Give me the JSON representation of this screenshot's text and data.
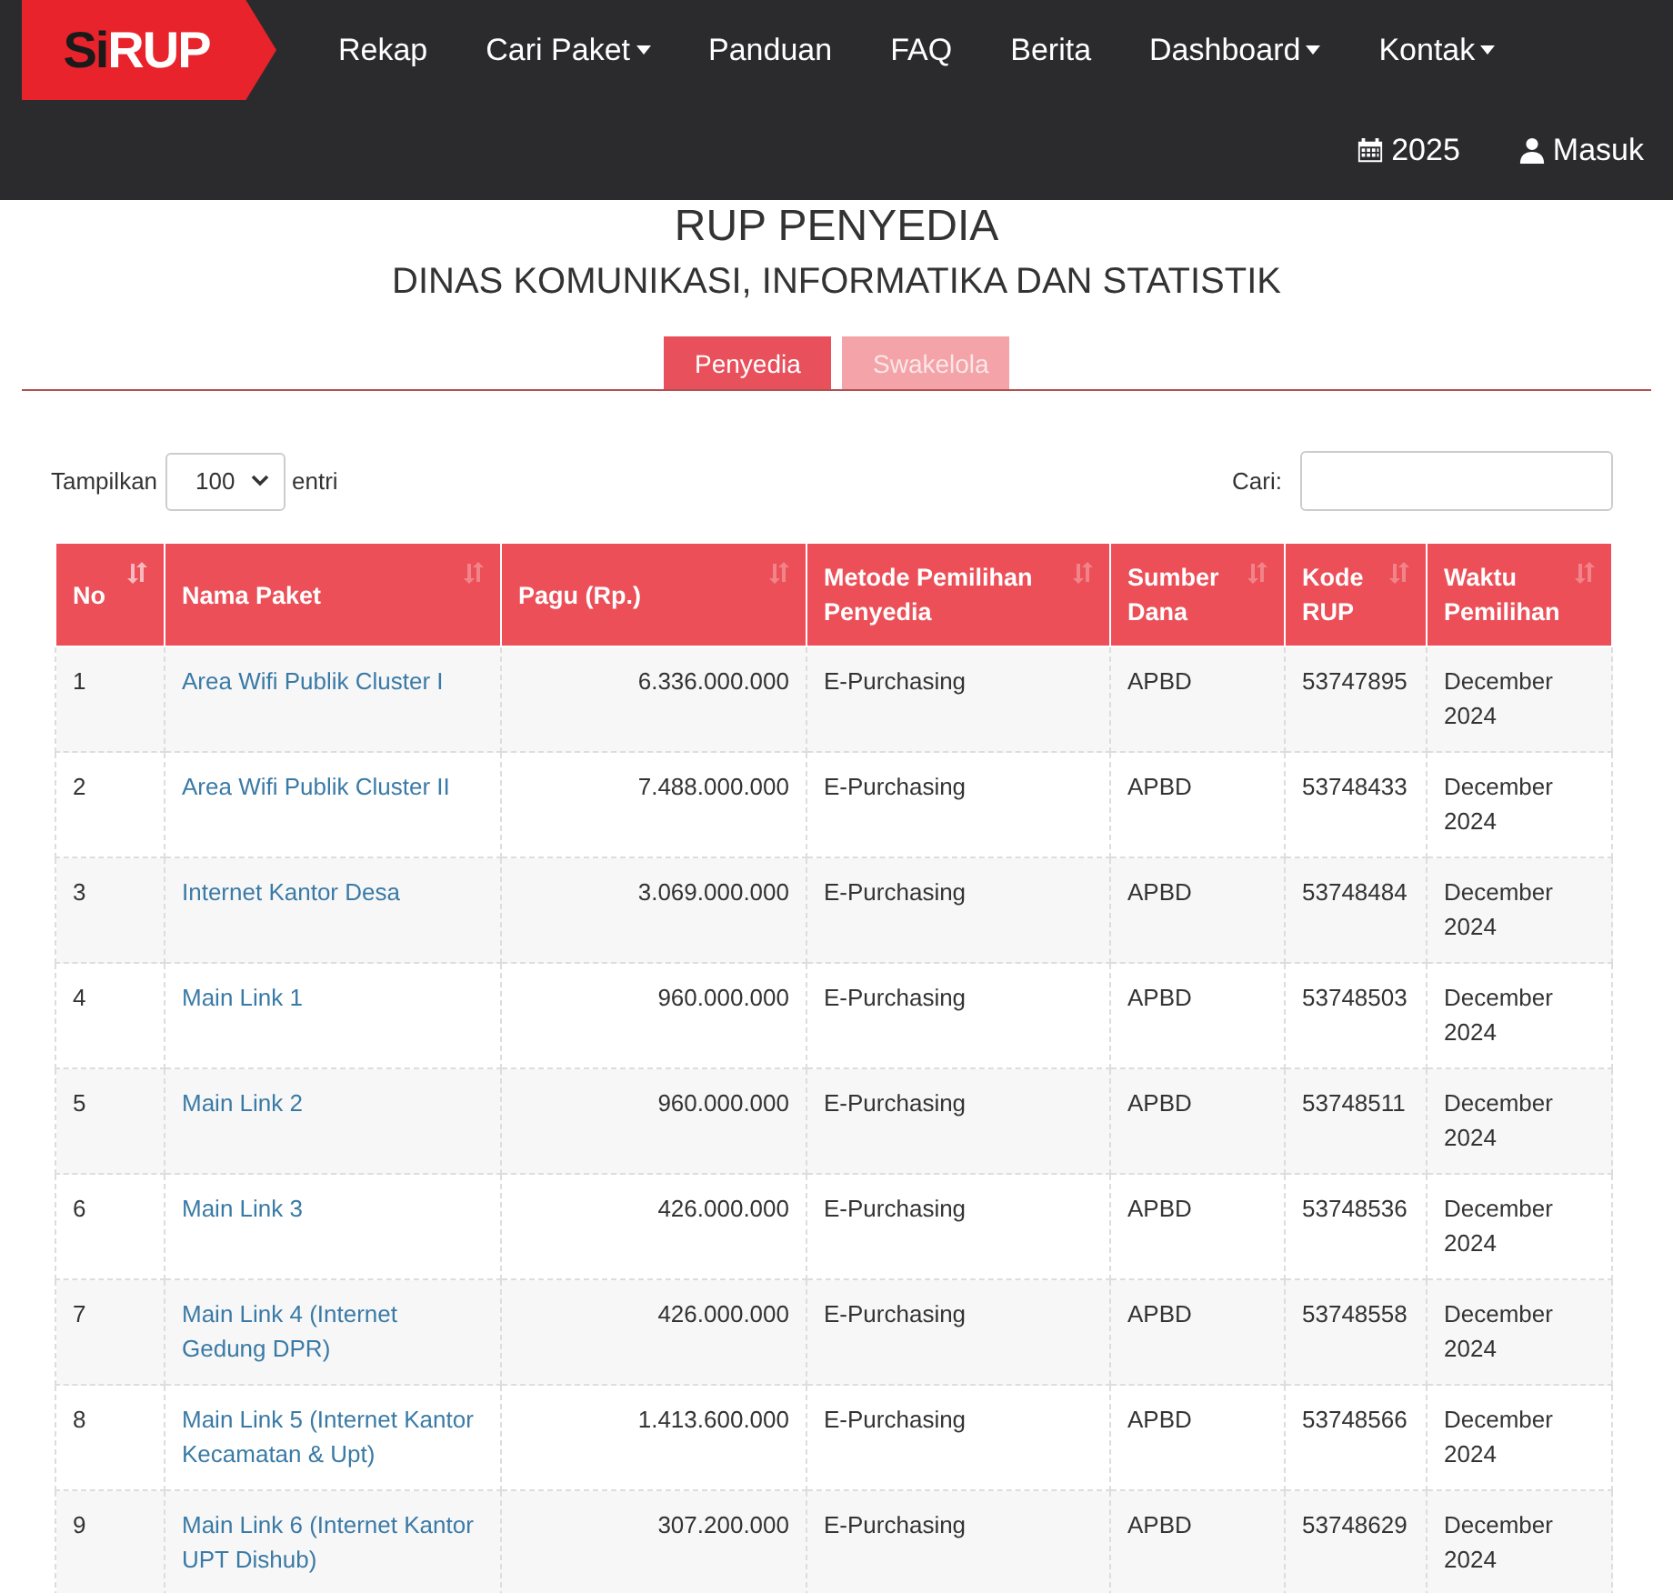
{
  "navbar": {
    "logo": {
      "prefix": "Si",
      "main": "RUP"
    },
    "menu": [
      {
        "label": "Rekap",
        "dropdown": false
      },
      {
        "label": "Cari Paket",
        "dropdown": true
      },
      {
        "label": "Panduan",
        "dropdown": false
      },
      {
        "label": "FAQ",
        "dropdown": false
      },
      {
        "label": "Berita",
        "dropdown": false
      },
      {
        "label": "Dashboard",
        "dropdown": true
      },
      {
        "label": "Kontak",
        "dropdown": true
      }
    ],
    "year": "2025",
    "login": "Masuk"
  },
  "title": "RUP PENYEDIA",
  "subtitle": "DINAS KOMUNIKASI, INFORMATIKA DAN STATISTIK",
  "tabs": [
    {
      "label": "Penyedia",
      "selected": true
    },
    {
      "label": "Swakelola",
      "selected": false
    }
  ],
  "length_control": {
    "prefix": "Tampilkan",
    "value": "100",
    "suffix": "entri"
  },
  "search": {
    "label": "Cari:"
  },
  "table": {
    "columns": [
      {
        "label": "No",
        "sorted": true
      },
      {
        "label": "Nama Paket",
        "sorted": false
      },
      {
        "label": "Pagu (Rp.)",
        "sorted": false
      },
      {
        "label": "Metode Pemilihan Penyedia",
        "sorted": false
      },
      {
        "label": "Sumber Dana",
        "sorted": false
      },
      {
        "label": "Kode RUP",
        "sorted": false
      },
      {
        "label": "Waktu Pemilihan",
        "sorted": false
      }
    ],
    "rows": [
      [
        "1",
        "Area Wifi Publik Cluster I",
        "6.336.000.000",
        "E-Purchasing",
        "APBD",
        "53747895",
        "December 2024"
      ],
      [
        "2",
        "Area Wifi Publik Cluster II",
        "7.488.000.000",
        "E-Purchasing",
        "APBD",
        "53748433",
        "December 2024"
      ],
      [
        "3",
        "Internet Kantor Desa",
        "3.069.000.000",
        "E-Purchasing",
        "APBD",
        "53748484",
        "December 2024"
      ],
      [
        "4",
        "Main Link 1",
        "960.000.000",
        "E-Purchasing",
        "APBD",
        "53748503",
        "December 2024"
      ],
      [
        "5",
        "Main Link 2",
        "960.000.000",
        "E-Purchasing",
        "APBD",
        "53748511",
        "December 2024"
      ],
      [
        "6",
        "Main Link 3",
        "426.000.000",
        "E-Purchasing",
        "APBD",
        "53748536",
        "December 2024"
      ],
      [
        "7",
        "Main Link 4 (Internet Gedung DPR)",
        "426.000.000",
        "E-Purchasing",
        "APBD",
        "53748558",
        "December 2024"
      ],
      [
        "8",
        "Main Link 5 (Internet Kantor Kecamatan & Upt)",
        "1.413.600.000",
        "E-Purchasing",
        "APBD",
        "53748566",
        "December 2024"
      ],
      [
        "9",
        "Main Link 6 (Internet Kantor UPT Dishub)",
        "307.200.000",
        "E-Purchasing",
        "APBD",
        "53748629",
        "December 2024"
      ]
    ]
  }
}
